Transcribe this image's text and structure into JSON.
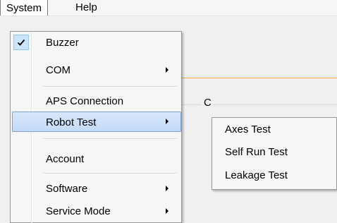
{
  "menubar": {
    "system": "System",
    "help": "Help"
  },
  "window": {
    "group_label": "C",
    "accent_color": "#f3a640"
  },
  "system_menu": {
    "items": [
      {
        "label": "Buzzer",
        "checked": true
      },
      {
        "label": "COM",
        "has_submenu": true
      },
      {
        "label": "APS Connection"
      },
      {
        "label": "Robot Test",
        "has_submenu": true,
        "highlighted": true
      },
      {
        "label": "Account"
      },
      {
        "label": "Software",
        "has_submenu": true
      },
      {
        "label": "Service Mode",
        "has_submenu": true
      }
    ]
  },
  "robot_test_submenu": {
    "items": [
      {
        "label": "Axes Test"
      },
      {
        "label": "Self Run Test"
      },
      {
        "label": "Leakage Test"
      }
    ]
  },
  "icons": {
    "check": "check-icon",
    "submenu_arrow": "chevron-right-icon"
  }
}
